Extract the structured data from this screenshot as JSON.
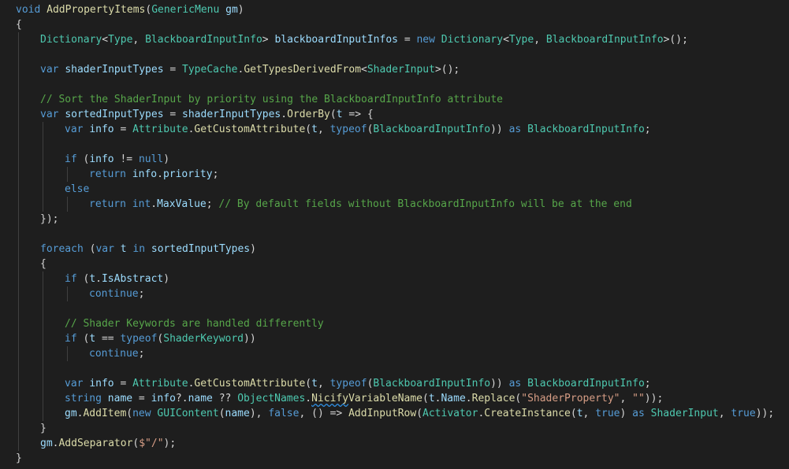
{
  "editor": {
    "language": "csharp",
    "colors": {
      "background": "#1e1e1e",
      "keyword": "#569cd6",
      "type": "#4ec9b0",
      "method": "#dcdcaa",
      "variable": "#9cdcfe",
      "string": "#d69d85",
      "comment": "#57a64a",
      "plain": "#d4d4d4",
      "indent_guide": "#404040",
      "squiggle": "#2f8ee0"
    },
    "lines": [
      {
        "indent": 0,
        "tokens": [
          [
            "kw",
            "void"
          ],
          [
            "pl",
            " "
          ],
          [
            "fn",
            "AddPropertyItems"
          ],
          [
            "pl",
            "("
          ],
          [
            "ty",
            "GenericMenu"
          ],
          [
            "pl",
            " "
          ],
          [
            "vr",
            "gm"
          ],
          [
            "pl",
            ")"
          ]
        ]
      },
      {
        "indent": 0,
        "tokens": [
          [
            "pl",
            "{"
          ]
        ]
      },
      {
        "indent": 1,
        "tokens": [
          [
            "ty",
            "Dictionary"
          ],
          [
            "pl",
            "<"
          ],
          [
            "ty",
            "Type"
          ],
          [
            "pl",
            ", "
          ],
          [
            "ty",
            "BlackboardInputInfo"
          ],
          [
            "pl",
            "> "
          ],
          [
            "vr",
            "blackboardInputInfos"
          ],
          [
            "pl",
            " = "
          ],
          [
            "kw",
            "new"
          ],
          [
            "pl",
            " "
          ],
          [
            "ty",
            "Dictionary"
          ],
          [
            "pl",
            "<"
          ],
          [
            "ty",
            "Type"
          ],
          [
            "pl",
            ", "
          ],
          [
            "ty",
            "BlackboardInputInfo"
          ],
          [
            "pl",
            ">();"
          ]
        ]
      },
      {
        "indent": 1,
        "tokens": []
      },
      {
        "indent": 1,
        "tokens": [
          [
            "kw",
            "var"
          ],
          [
            "pl",
            " "
          ],
          [
            "vr",
            "shaderInputTypes"
          ],
          [
            "pl",
            " = "
          ],
          [
            "ty",
            "TypeCache"
          ],
          [
            "pl",
            "."
          ],
          [
            "fn",
            "GetTypesDerivedFrom"
          ],
          [
            "pl",
            "<"
          ],
          [
            "ty",
            "ShaderInput"
          ],
          [
            "pl",
            ">();"
          ]
        ]
      },
      {
        "indent": 1,
        "tokens": []
      },
      {
        "indent": 1,
        "tokens": [
          [
            "cm",
            "// Sort the ShaderInput by priority using the BlackboardInputInfo attribute"
          ]
        ]
      },
      {
        "indent": 1,
        "tokens": [
          [
            "kw",
            "var"
          ],
          [
            "pl",
            " "
          ],
          [
            "vr",
            "sortedInputTypes"
          ],
          [
            "pl",
            " = "
          ],
          [
            "vr",
            "shaderInputTypes"
          ],
          [
            "pl",
            "."
          ],
          [
            "fn",
            "OrderBy"
          ],
          [
            "pl",
            "("
          ],
          [
            "vr",
            "t"
          ],
          [
            "pl",
            " => {"
          ]
        ]
      },
      {
        "indent": 2,
        "tokens": [
          [
            "kw",
            "var"
          ],
          [
            "pl",
            " "
          ],
          [
            "vr",
            "info"
          ],
          [
            "pl",
            " = "
          ],
          [
            "ty",
            "Attribute"
          ],
          [
            "pl",
            "."
          ],
          [
            "fn",
            "GetCustomAttribute"
          ],
          [
            "pl",
            "("
          ],
          [
            "vr",
            "t"
          ],
          [
            "pl",
            ", "
          ],
          [
            "kw",
            "typeof"
          ],
          [
            "pl",
            "("
          ],
          [
            "ty",
            "BlackboardInputInfo"
          ],
          [
            "pl",
            ")) "
          ],
          [
            "kw",
            "as"
          ],
          [
            "pl",
            " "
          ],
          [
            "ty",
            "BlackboardInputInfo"
          ],
          [
            "pl",
            ";"
          ]
        ]
      },
      {
        "indent": 2,
        "tokens": []
      },
      {
        "indent": 2,
        "tokens": [
          [
            "kw",
            "if"
          ],
          [
            "pl",
            " ("
          ],
          [
            "vr",
            "info"
          ],
          [
            "pl",
            " != "
          ],
          [
            "kw",
            "null"
          ],
          [
            "pl",
            ")"
          ]
        ]
      },
      {
        "indent": 3,
        "tokens": [
          [
            "kw",
            "return"
          ],
          [
            "pl",
            " "
          ],
          [
            "vr",
            "info"
          ],
          [
            "pl",
            "."
          ],
          [
            "vr",
            "priority"
          ],
          [
            "pl",
            ";"
          ]
        ]
      },
      {
        "indent": 2,
        "tokens": [
          [
            "kw",
            "else"
          ]
        ]
      },
      {
        "indent": 3,
        "tokens": [
          [
            "kw",
            "return"
          ],
          [
            "pl",
            " "
          ],
          [
            "kw",
            "int"
          ],
          [
            "pl",
            "."
          ],
          [
            "vr",
            "MaxValue"
          ],
          [
            "pl",
            "; "
          ],
          [
            "cm",
            "// By default fields without BlackboardInputInfo will be at the end"
          ]
        ]
      },
      {
        "indent": 1,
        "tokens": [
          [
            "pl",
            "});"
          ]
        ]
      },
      {
        "indent": 1,
        "tokens": []
      },
      {
        "indent": 1,
        "tokens": [
          [
            "kw",
            "foreach"
          ],
          [
            "pl",
            " ("
          ],
          [
            "kw",
            "var"
          ],
          [
            "pl",
            " "
          ],
          [
            "vr",
            "t"
          ],
          [
            "pl",
            " "
          ],
          [
            "kw",
            "in"
          ],
          [
            "pl",
            " "
          ],
          [
            "vr",
            "sortedInputTypes"
          ],
          [
            "pl",
            ")"
          ]
        ]
      },
      {
        "indent": 1,
        "tokens": [
          [
            "pl",
            "{"
          ]
        ]
      },
      {
        "indent": 2,
        "tokens": [
          [
            "kw",
            "if"
          ],
          [
            "pl",
            " ("
          ],
          [
            "vr",
            "t"
          ],
          [
            "pl",
            "."
          ],
          [
            "vr",
            "IsAbstract"
          ],
          [
            "pl",
            ")"
          ]
        ]
      },
      {
        "indent": 3,
        "tokens": [
          [
            "kw",
            "continue"
          ],
          [
            "pl",
            ";"
          ]
        ]
      },
      {
        "indent": 2,
        "tokens": []
      },
      {
        "indent": 2,
        "tokens": [
          [
            "cm",
            "// Shader Keywords are handled differently"
          ]
        ]
      },
      {
        "indent": 2,
        "tokens": [
          [
            "kw",
            "if"
          ],
          [
            "pl",
            " ("
          ],
          [
            "vr",
            "t"
          ],
          [
            "pl",
            " == "
          ],
          [
            "kw",
            "typeof"
          ],
          [
            "pl",
            "("
          ],
          [
            "ty",
            "ShaderKeyword"
          ],
          [
            "pl",
            "))"
          ]
        ]
      },
      {
        "indent": 3,
        "tokens": [
          [
            "kw",
            "continue"
          ],
          [
            "pl",
            ";"
          ]
        ]
      },
      {
        "indent": 2,
        "tokens": []
      },
      {
        "indent": 2,
        "tokens": [
          [
            "kw",
            "var"
          ],
          [
            "pl",
            " "
          ],
          [
            "vr",
            "info"
          ],
          [
            "pl",
            " = "
          ],
          [
            "ty",
            "Attribute"
          ],
          [
            "pl",
            "."
          ],
          [
            "fn",
            "GetCustomAttribute"
          ],
          [
            "pl",
            "("
          ],
          [
            "vr",
            "t"
          ],
          [
            "pl",
            ", "
          ],
          [
            "kw",
            "typeof"
          ],
          [
            "pl",
            "("
          ],
          [
            "ty",
            "BlackboardInputInfo"
          ],
          [
            "pl",
            ")) "
          ],
          [
            "kw",
            "as"
          ],
          [
            "pl",
            " "
          ],
          [
            "ty",
            "BlackboardInputInfo"
          ],
          [
            "pl",
            ";"
          ]
        ]
      },
      {
        "indent": 2,
        "tokens": [
          [
            "kw",
            "string"
          ],
          [
            "pl",
            " "
          ],
          [
            "vr",
            "name"
          ],
          [
            "pl",
            " = "
          ],
          [
            "vr",
            "info"
          ],
          [
            "pl",
            "?."
          ],
          [
            "vr",
            "name"
          ],
          [
            "pl",
            " ?? "
          ],
          [
            "ty",
            "ObjectNames"
          ],
          [
            "pl",
            "."
          ],
          [
            "fn sq",
            "Nicify"
          ],
          [
            "fn",
            "VariableName"
          ],
          [
            "pl",
            "("
          ],
          [
            "vr",
            "t"
          ],
          [
            "pl",
            "."
          ],
          [
            "vr",
            "Name"
          ],
          [
            "pl",
            "."
          ],
          [
            "fn",
            "Replace"
          ],
          [
            "pl",
            "("
          ],
          [
            "st",
            "\"ShaderProperty\""
          ],
          [
            "pl",
            ", "
          ],
          [
            "st",
            "\"\""
          ],
          [
            "pl",
            "));"
          ]
        ]
      },
      {
        "indent": 2,
        "tokens": [
          [
            "vr",
            "gm"
          ],
          [
            "pl",
            "."
          ],
          [
            "fn",
            "AddItem"
          ],
          [
            "pl",
            "("
          ],
          [
            "kw",
            "new"
          ],
          [
            "pl",
            " "
          ],
          [
            "ty",
            "GUIContent"
          ],
          [
            "pl",
            "("
          ],
          [
            "vr",
            "name"
          ],
          [
            "pl",
            "), "
          ],
          [
            "kw",
            "false"
          ],
          [
            "pl",
            ", () => "
          ],
          [
            "fn",
            "AddInputRow"
          ],
          [
            "pl",
            "("
          ],
          [
            "ty",
            "Activator"
          ],
          [
            "pl",
            "."
          ],
          [
            "fn",
            "CreateInstance"
          ],
          [
            "pl",
            "("
          ],
          [
            "vr",
            "t"
          ],
          [
            "pl",
            ", "
          ],
          [
            "kw",
            "true"
          ],
          [
            "pl",
            ") "
          ],
          [
            "kw",
            "as"
          ],
          [
            "pl",
            " "
          ],
          [
            "ty",
            "ShaderInput"
          ],
          [
            "pl",
            ", "
          ],
          [
            "kw",
            "true"
          ],
          [
            "pl",
            "));"
          ]
        ]
      },
      {
        "indent": 1,
        "tokens": [
          [
            "pl",
            "}"
          ]
        ]
      },
      {
        "indent": 1,
        "tokens": [
          [
            "vr",
            "gm"
          ],
          [
            "pl",
            "."
          ],
          [
            "fn",
            "AddSeparator"
          ],
          [
            "pl",
            "("
          ],
          [
            "st",
            "$\"/\""
          ],
          [
            "pl",
            ");"
          ]
        ]
      },
      {
        "indent": 0,
        "tokens": [
          [
            "pl",
            "}"
          ]
        ]
      }
    ]
  }
}
